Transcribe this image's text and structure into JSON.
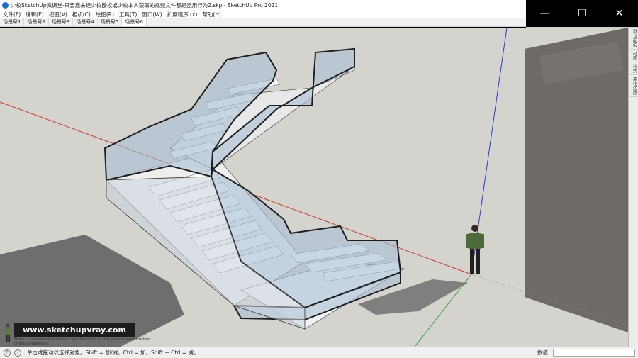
{
  "window": {
    "title": "少校SketchUp微课堂-只要您未经少校授权或少校本人获取的视频文件都是盗用行为2.skp - SketchUp Pro 2021",
    "controls": [
      "—",
      "☐",
      "✕"
    ]
  },
  "menu": [
    "文件(F)",
    "编辑(E)",
    "视图(V)",
    "相机(C)",
    "绘图(R)",
    "工具(T)",
    "窗口(W)",
    "扩展程序 (x)",
    "帮助(H)"
  ],
  "scene_tabs": [
    "场景号1",
    "场景号2",
    "场景号3",
    "场景号4",
    "场景号5",
    "场景号6"
  ],
  "active_tab": 5,
  "tray": [
    "默认面板",
    "材质",
    "样式",
    "柔化边线"
  ],
  "watermark": {
    "url": "www.sketchupvray.com",
    "subtitle": "There is no reservation to teach you SketchUp so that you can learn the best original knowledge."
  },
  "status": {
    "hint": "单击或拖动以选择对象。Shift = 加/减。Ctrl = 加。Shift + Ctrl = 减。",
    "vcb_label": "数值",
    "vcb_value": ""
  },
  "colors": {
    "background": "#d4d3ce",
    "glass": "#a9bfd6",
    "axis_red": "#c03a2b",
    "axis_green": "#2ea043",
    "axis_blue": "#2a3ad0"
  }
}
